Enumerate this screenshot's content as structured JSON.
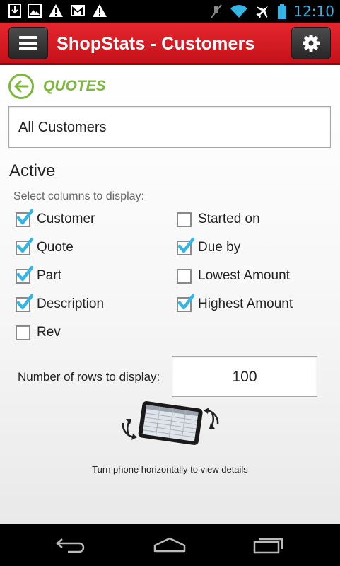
{
  "status_bar": {
    "time": "12:10",
    "left_icons": [
      "download-icon",
      "image-icon",
      "warning-icon",
      "gmail-icon",
      "warning-icon"
    ],
    "right_icons": [
      "mute-icon",
      "wifi-icon",
      "airplane-icon",
      "battery-icon"
    ],
    "time_color": "#33b5e5"
  },
  "action_bar": {
    "title": "ShopStats - Customers",
    "color": "#d81b23",
    "menu_icon": "menu-icon",
    "settings_icon": "gear-icon"
  },
  "back_nav": {
    "label": "QUOTES",
    "color": "#7cb83a"
  },
  "customer_filter": {
    "value": "All Customers"
  },
  "section": {
    "title": "Active",
    "hint": "Select columns to display:"
  },
  "columns": [
    {
      "label": "Customer",
      "checked": true
    },
    {
      "label": "Started on",
      "checked": false
    },
    {
      "label": "Quote",
      "checked": true
    },
    {
      "label": "Due by",
      "checked": true
    },
    {
      "label": "Part",
      "checked": true
    },
    {
      "label": "Lowest Amount",
      "checked": false
    },
    {
      "label": "Description",
      "checked": true
    },
    {
      "label": "Highest Amount",
      "checked": true
    },
    {
      "label": "Rev",
      "checked": false
    }
  ],
  "rows_setting": {
    "label": "Number of rows to display:",
    "value": "100"
  },
  "rotate_hint": {
    "caption": "Turn phone horizontally to view details"
  },
  "nav_bar": {
    "buttons": [
      "back-icon",
      "home-icon",
      "recent-apps-icon"
    ]
  },
  "colors": {
    "check": "#33b5e5"
  }
}
